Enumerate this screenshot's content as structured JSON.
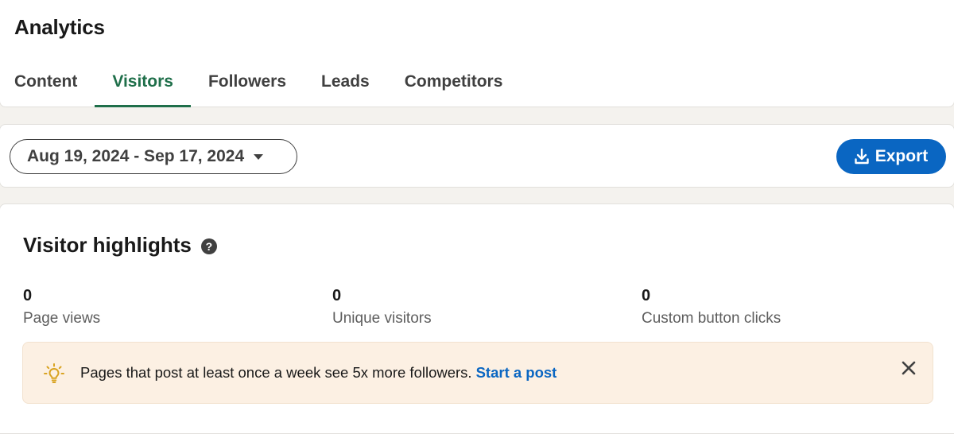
{
  "header": {
    "title": "Analytics",
    "tabs": [
      {
        "label": "Content"
      },
      {
        "label": "Visitors"
      },
      {
        "label": "Followers"
      },
      {
        "label": "Leads"
      },
      {
        "label": "Competitors"
      }
    ],
    "active_tab": "Visitors"
  },
  "filters": {
    "date_range": "Aug 19, 2024 - Sep 17, 2024",
    "export_label": "Export"
  },
  "highlights": {
    "title": "Visitor highlights",
    "metrics": [
      {
        "value": "0",
        "label": "Page views"
      },
      {
        "value": "0",
        "label": "Unique visitors"
      },
      {
        "value": "0",
        "label": "Custom button clicks"
      }
    ],
    "banner": {
      "text": "Pages that post at least once a week see 5x more followers.",
      "link": "Start a post"
    }
  },
  "colors": {
    "accent_green": "#1f6f4a",
    "primary_blue": "#0a66c2",
    "banner_bg": "#fcf0e3",
    "bulb": "#d9a321"
  },
  "icons": [
    "caret-down-icon",
    "download-icon",
    "help-icon",
    "lightbulb-icon",
    "close-icon"
  ]
}
